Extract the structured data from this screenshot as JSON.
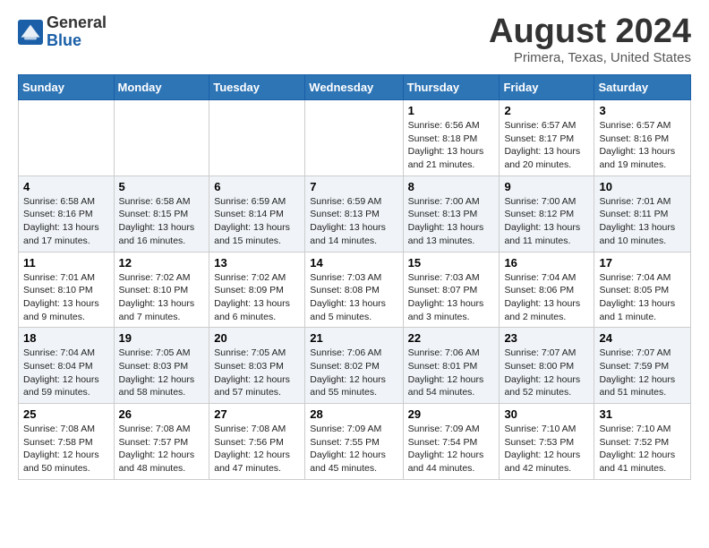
{
  "header": {
    "logo_general": "General",
    "logo_blue": "Blue",
    "title": "August 2024",
    "subtitle": "Primera, Texas, United States"
  },
  "columns": [
    "Sunday",
    "Monday",
    "Tuesday",
    "Wednesday",
    "Thursday",
    "Friday",
    "Saturday"
  ],
  "weeks": [
    [
      {
        "day": "",
        "detail": ""
      },
      {
        "day": "",
        "detail": ""
      },
      {
        "day": "",
        "detail": ""
      },
      {
        "day": "",
        "detail": ""
      },
      {
        "day": "1",
        "detail": "Sunrise: 6:56 AM\nSunset: 8:18 PM\nDaylight: 13 hours\nand 21 minutes."
      },
      {
        "day": "2",
        "detail": "Sunrise: 6:57 AM\nSunset: 8:17 PM\nDaylight: 13 hours\nand 20 minutes."
      },
      {
        "day": "3",
        "detail": "Sunrise: 6:57 AM\nSunset: 8:16 PM\nDaylight: 13 hours\nand 19 minutes."
      }
    ],
    [
      {
        "day": "4",
        "detail": "Sunrise: 6:58 AM\nSunset: 8:16 PM\nDaylight: 13 hours\nand 17 minutes."
      },
      {
        "day": "5",
        "detail": "Sunrise: 6:58 AM\nSunset: 8:15 PM\nDaylight: 13 hours\nand 16 minutes."
      },
      {
        "day": "6",
        "detail": "Sunrise: 6:59 AM\nSunset: 8:14 PM\nDaylight: 13 hours\nand 15 minutes."
      },
      {
        "day": "7",
        "detail": "Sunrise: 6:59 AM\nSunset: 8:13 PM\nDaylight: 13 hours\nand 14 minutes."
      },
      {
        "day": "8",
        "detail": "Sunrise: 7:00 AM\nSunset: 8:13 PM\nDaylight: 13 hours\nand 13 minutes."
      },
      {
        "day": "9",
        "detail": "Sunrise: 7:00 AM\nSunset: 8:12 PM\nDaylight: 13 hours\nand 11 minutes."
      },
      {
        "day": "10",
        "detail": "Sunrise: 7:01 AM\nSunset: 8:11 PM\nDaylight: 13 hours\nand 10 minutes."
      }
    ],
    [
      {
        "day": "11",
        "detail": "Sunrise: 7:01 AM\nSunset: 8:10 PM\nDaylight: 13 hours\nand 9 minutes."
      },
      {
        "day": "12",
        "detail": "Sunrise: 7:02 AM\nSunset: 8:10 PM\nDaylight: 13 hours\nand 7 minutes."
      },
      {
        "day": "13",
        "detail": "Sunrise: 7:02 AM\nSunset: 8:09 PM\nDaylight: 13 hours\nand 6 minutes."
      },
      {
        "day": "14",
        "detail": "Sunrise: 7:03 AM\nSunset: 8:08 PM\nDaylight: 13 hours\nand 5 minutes."
      },
      {
        "day": "15",
        "detail": "Sunrise: 7:03 AM\nSunset: 8:07 PM\nDaylight: 13 hours\nand 3 minutes."
      },
      {
        "day": "16",
        "detail": "Sunrise: 7:04 AM\nSunset: 8:06 PM\nDaylight: 13 hours\nand 2 minutes."
      },
      {
        "day": "17",
        "detail": "Sunrise: 7:04 AM\nSunset: 8:05 PM\nDaylight: 13 hours\nand 1 minute."
      }
    ],
    [
      {
        "day": "18",
        "detail": "Sunrise: 7:04 AM\nSunset: 8:04 PM\nDaylight: 12 hours\nand 59 minutes."
      },
      {
        "day": "19",
        "detail": "Sunrise: 7:05 AM\nSunset: 8:03 PM\nDaylight: 12 hours\nand 58 minutes."
      },
      {
        "day": "20",
        "detail": "Sunrise: 7:05 AM\nSunset: 8:03 PM\nDaylight: 12 hours\nand 57 minutes."
      },
      {
        "day": "21",
        "detail": "Sunrise: 7:06 AM\nSunset: 8:02 PM\nDaylight: 12 hours\nand 55 minutes."
      },
      {
        "day": "22",
        "detail": "Sunrise: 7:06 AM\nSunset: 8:01 PM\nDaylight: 12 hours\nand 54 minutes."
      },
      {
        "day": "23",
        "detail": "Sunrise: 7:07 AM\nSunset: 8:00 PM\nDaylight: 12 hours\nand 52 minutes."
      },
      {
        "day": "24",
        "detail": "Sunrise: 7:07 AM\nSunset: 7:59 PM\nDaylight: 12 hours\nand 51 minutes."
      }
    ],
    [
      {
        "day": "25",
        "detail": "Sunrise: 7:08 AM\nSunset: 7:58 PM\nDaylight: 12 hours\nand 50 minutes."
      },
      {
        "day": "26",
        "detail": "Sunrise: 7:08 AM\nSunset: 7:57 PM\nDaylight: 12 hours\nand 48 minutes."
      },
      {
        "day": "27",
        "detail": "Sunrise: 7:08 AM\nSunset: 7:56 PM\nDaylight: 12 hours\nand 47 minutes."
      },
      {
        "day": "28",
        "detail": "Sunrise: 7:09 AM\nSunset: 7:55 PM\nDaylight: 12 hours\nand 45 minutes."
      },
      {
        "day": "29",
        "detail": "Sunrise: 7:09 AM\nSunset: 7:54 PM\nDaylight: 12 hours\nand 44 minutes."
      },
      {
        "day": "30",
        "detail": "Sunrise: 7:10 AM\nSunset: 7:53 PM\nDaylight: 12 hours\nand 42 minutes."
      },
      {
        "day": "31",
        "detail": "Sunrise: 7:10 AM\nSunset: 7:52 PM\nDaylight: 12 hours\nand 41 minutes."
      }
    ]
  ]
}
